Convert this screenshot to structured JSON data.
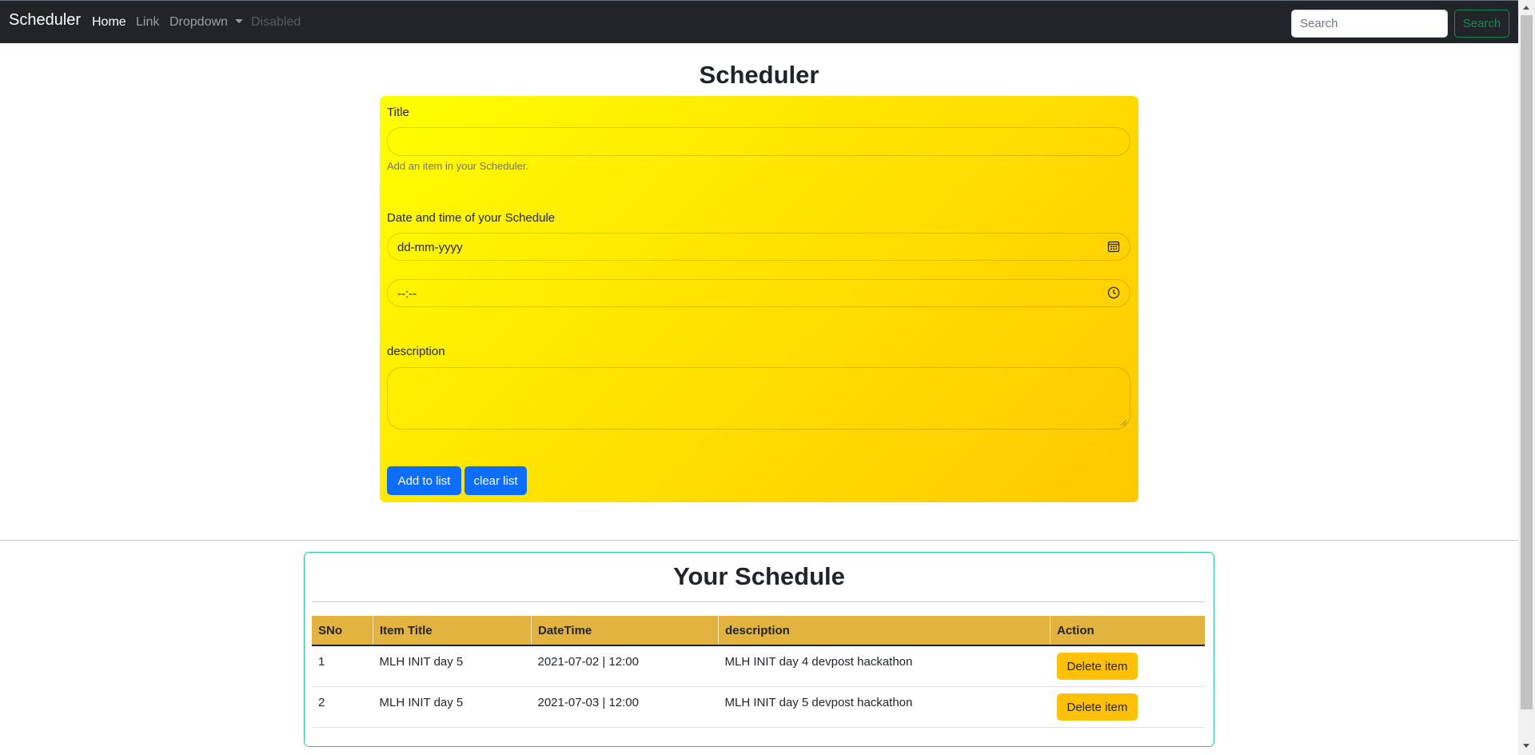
{
  "navbar": {
    "brand": "Scheduler",
    "links": [
      "Home",
      "Link",
      "Dropdown",
      "Disabled"
    ],
    "search_placeholder": "Search",
    "search_button": "Search"
  },
  "form": {
    "heading": "Scheduler",
    "title_label": "Title",
    "title_value": "",
    "title_help": "Add an item in your Scheduler.",
    "datetime_label": "Date and time of your Schedule",
    "date_placeholder": "dd-mm-yyyy",
    "time_placeholder": "--:--",
    "description_label": "description",
    "description_value": "",
    "add_button": "Add to list",
    "clear_button": "clear list"
  },
  "schedule": {
    "heading": "Your Schedule",
    "columns": [
      "SNo",
      "Item Title",
      "DateTime",
      "description",
      "Action"
    ],
    "rows": [
      {
        "sno": "1",
        "title": "MLH INIT day 5",
        "datetime": "2021-07-02 | 12:00",
        "description": "MLH INIT day 4 devpost hackathon",
        "action": "Delete item"
      },
      {
        "sno": "2",
        "title": "MLH INIT day 5",
        "datetime": "2021-07-03 | 12:00",
        "description": "MLH INIT day 5 devpost hackathon",
        "action": "Delete item"
      }
    ]
  },
  "colors": {
    "navbar": "#212529",
    "form_gradient_start": "#ffff00",
    "form_gradient_end": "#ffc800",
    "primary_button": "#0d6efd",
    "table_header": "#e2b33e",
    "delete_button": "#ffc107",
    "schedule_border": "#20c997",
    "search_button": "#198754"
  },
  "icons": [
    "calendar-icon",
    "clock-icon",
    "caret-down-icon"
  ]
}
